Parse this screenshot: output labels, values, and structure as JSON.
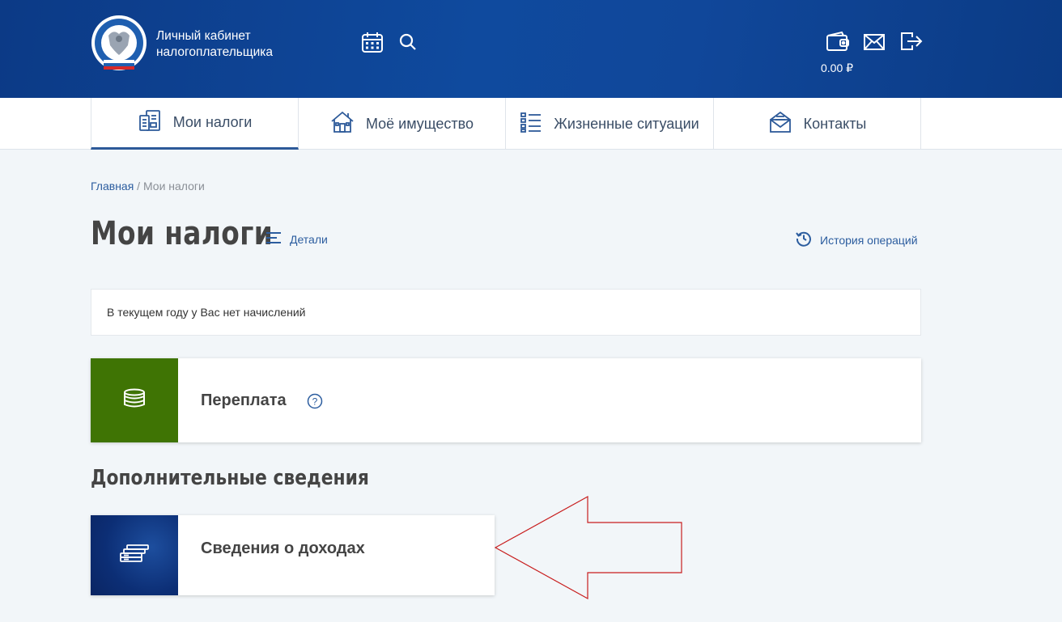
{
  "header": {
    "brand_line1": "Личный кабинет",
    "brand_line2": "налогоплательщика",
    "balance": "0.00 ₽",
    "icons": [
      "calendar-icon",
      "search-icon",
      "wallet-icon",
      "mail-icon",
      "logout-icon"
    ],
    "colors": {
      "header_bg": "#0f4a9e",
      "accent": "#2c5d9f"
    }
  },
  "nav": {
    "items": [
      {
        "label": "Мои налоги",
        "icon": "my-taxes-icon",
        "active": true
      },
      {
        "label": "Моё имущество",
        "icon": "property-icon",
        "active": false
      },
      {
        "label": "Жизненные ситуации",
        "icon": "list-icon",
        "active": false
      },
      {
        "label": "Контакты",
        "icon": "envelope-icon",
        "active": false
      }
    ]
  },
  "breadcrumb": {
    "home": "Главная",
    "separator": " / ",
    "current": "Мои налоги"
  },
  "page": {
    "title": "Мои налоги",
    "details_label": "Детали",
    "history_label": "История операций"
  },
  "notice": "В текущем году у Вас нет начислений",
  "overpayment_card": {
    "title": "Переплата",
    "help": "?",
    "tile_color": "#3f7404"
  },
  "additional": {
    "section_title": "Дополнительные сведения",
    "income_card": {
      "title": "Сведения о доходах",
      "tile_color": "#0c2e75"
    }
  },
  "annotation": {
    "arrow_color": "#c81e1e"
  }
}
